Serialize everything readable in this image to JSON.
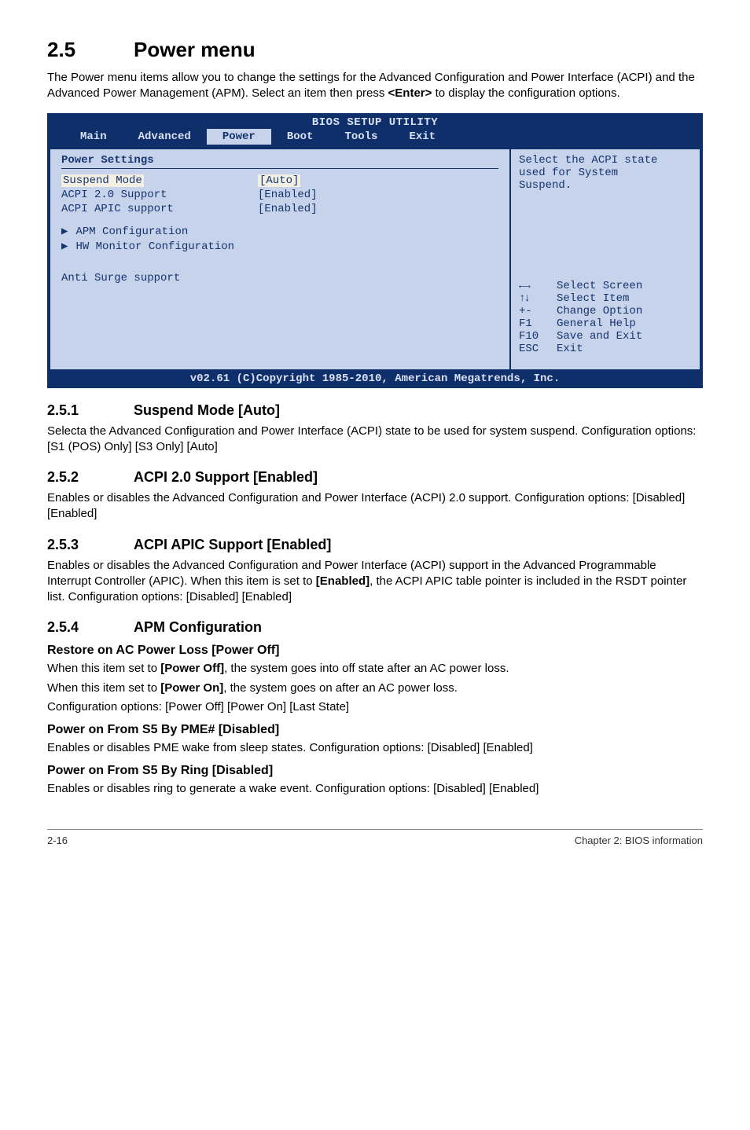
{
  "header": {
    "section_number": "2.5",
    "section_title": "Power menu",
    "intro": "The Power menu items allow you to change the settings for the Advanced Configuration and Power Interface (ACPI) and the Advanced Power Management (APM). Select an item then press ",
    "intro_bold": "<Enter>",
    "intro_tail": " to display the configuration options."
  },
  "bios": {
    "title": "BIOS SETUP UTILITY",
    "tabs": [
      "Main",
      "Advanced",
      "Power",
      "Boot",
      "Tools",
      "Exit"
    ],
    "selected_tab_index": 2,
    "left": {
      "heading": "Power Settings",
      "rows": [
        {
          "label": "Suspend Mode",
          "value": "[Auto]",
          "selected": true
        },
        {
          "label": "ACPI 2.0 Support",
          "value": "[Enabled]",
          "selected": false
        },
        {
          "label": "ACPI APIC support",
          "value": "[Enabled]",
          "selected": false
        }
      ],
      "submenus": [
        "APM Configuration",
        "HW Monitor Configuration"
      ],
      "extra": "Anti Surge support"
    },
    "right": {
      "help_top_line1": "Select the ACPI state",
      "help_top_line2": "used for System",
      "help_top_line3": "Suspend.",
      "legend": [
        {
          "key_icon": "lr",
          "key": "",
          "desc": "Select Screen"
        },
        {
          "key_icon": "ud",
          "key": "",
          "desc": "Select Item"
        },
        {
          "key_icon": "",
          "key": "+-",
          "desc": "Change Option"
        },
        {
          "key_icon": "",
          "key": "F1",
          "desc": "General Help"
        },
        {
          "key_icon": "",
          "key": "F10",
          "desc": "Save and Exit"
        },
        {
          "key_icon": "",
          "key": "ESC",
          "desc": "Exit"
        }
      ]
    },
    "footer": "v02.61 (C)Copyright 1985-2010, American Megatrends, Inc."
  },
  "s251": {
    "num": "2.5.1",
    "title": "Suspend Mode [Auto]",
    "body": "Selecta the Advanced Configuration and Power Interface (ACPI) state to be used for system suspend. Configuration options: [S1 (POS) Only] [S3 Only] [Auto]"
  },
  "s252": {
    "num": "2.5.2",
    "title": "ACPI 2.0 Support [Enabled]",
    "body": "Enables or disables the Advanced Configuration and Power Interface (ACPI) 2.0 support. Configuration options: [Disabled] [Enabled]"
  },
  "s253": {
    "num": "2.5.3",
    "title": "ACPI APIC Support [Enabled]",
    "body_pre": "Enables or disables the Advanced Configuration and Power Interface (ACPI) support in the Advanced Programmable Interrupt Controller (APIC). When this item is set to ",
    "body_bold": "[Enabled]",
    "body_post": ", the ACPI APIC table pointer is included in the RSDT pointer list. Configuration options: [Disabled] [Enabled]"
  },
  "s254": {
    "num": "2.5.4",
    "title": "APM Configuration",
    "sub1": {
      "title": "Restore on AC Power Loss [Power Off]",
      "line1_pre": "When this item set to ",
      "line1_bold": "[Power Off]",
      "line1_post": ", the system goes into off state after an AC power loss.",
      "line2_pre": "When this item set to ",
      "line2_bold": "[Power On]",
      "line2_post": ", the system goes on after an AC power loss.",
      "line3": "Configuration options: [Power Off] [Power On] [Last State]"
    },
    "sub2": {
      "title": "Power on From S5 By PME# [Disabled]",
      "body": "Enables or disables PME wake from sleep states. Configuration options: [Disabled] [Enabled]"
    },
    "sub3": {
      "title": "Power on From S5 By Ring [Disabled]",
      "body": "Enables or disables ring to generate a wake event. Configuration options: [Disabled] [Enabled]"
    }
  },
  "page_footer": {
    "left": "2-16",
    "right": "Chapter 2: BIOS information"
  }
}
